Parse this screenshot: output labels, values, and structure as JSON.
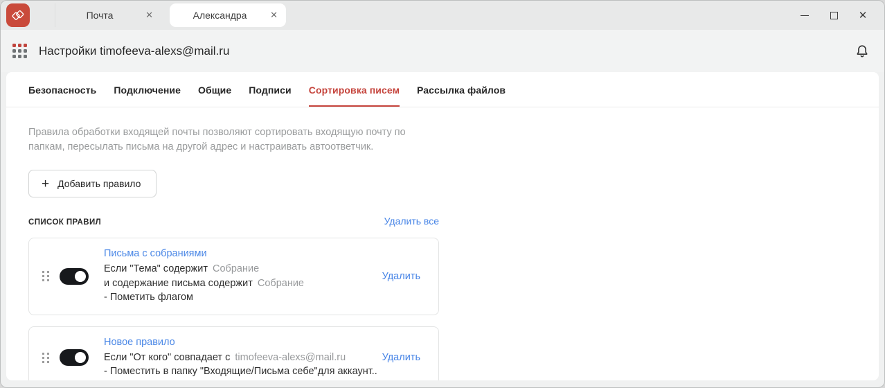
{
  "titlebar": {
    "tabs": [
      {
        "label": "Почта",
        "active": false
      },
      {
        "label": "Александра",
        "active": true
      }
    ]
  },
  "icons": {
    "close_tab": "✕",
    "close_window": "✕",
    "plus": "+"
  },
  "header": {
    "title": "Настройки timofeeva-alexs@mail.ru"
  },
  "nav": {
    "active_index": 4,
    "tabs": [
      {
        "label": "Безопасность"
      },
      {
        "label": "Подключение"
      },
      {
        "label": "Общие"
      },
      {
        "label": "Подписи"
      },
      {
        "label": "Сортировка писем"
      },
      {
        "label": "Рассылка файлов"
      }
    ]
  },
  "main": {
    "description": "Правила обработки входящей почты позволяют сортировать входящую почту по папкам, пересылать письма на другой адрес и настраивать автоответчик.",
    "add_rule_button": "Добавить правило",
    "rules_list_label": "СПИСОК ПРАВИЛ",
    "delete_all_link": "Удалить все",
    "rules": [
      {
        "title": "Письма с собраниями",
        "enabled": true,
        "line1_text": "Если \"Тема\" содержит",
        "line1_value": "Собрание",
        "line2_text": "и содержание письма содержит",
        "line2_value": "Собрание",
        "line3_text": "- Пометить флагом",
        "delete_label": "Удалить"
      },
      {
        "title": "Новое правило",
        "enabled": true,
        "line1_text": "Если \"От кого\" совпадает с",
        "line1_value": "timofeeva-alexs@mail.ru",
        "line2_text": "- Поместить в папку \"Входящие/Письма себе\"для аккаунт...",
        "delete_label": "Удалить"
      }
    ]
  },
  "colors": {
    "accent_red": "#c5443c",
    "link_blue": "#4583e6",
    "logo_red": "#c94a3b",
    "toggle_on": "#17191c"
  }
}
